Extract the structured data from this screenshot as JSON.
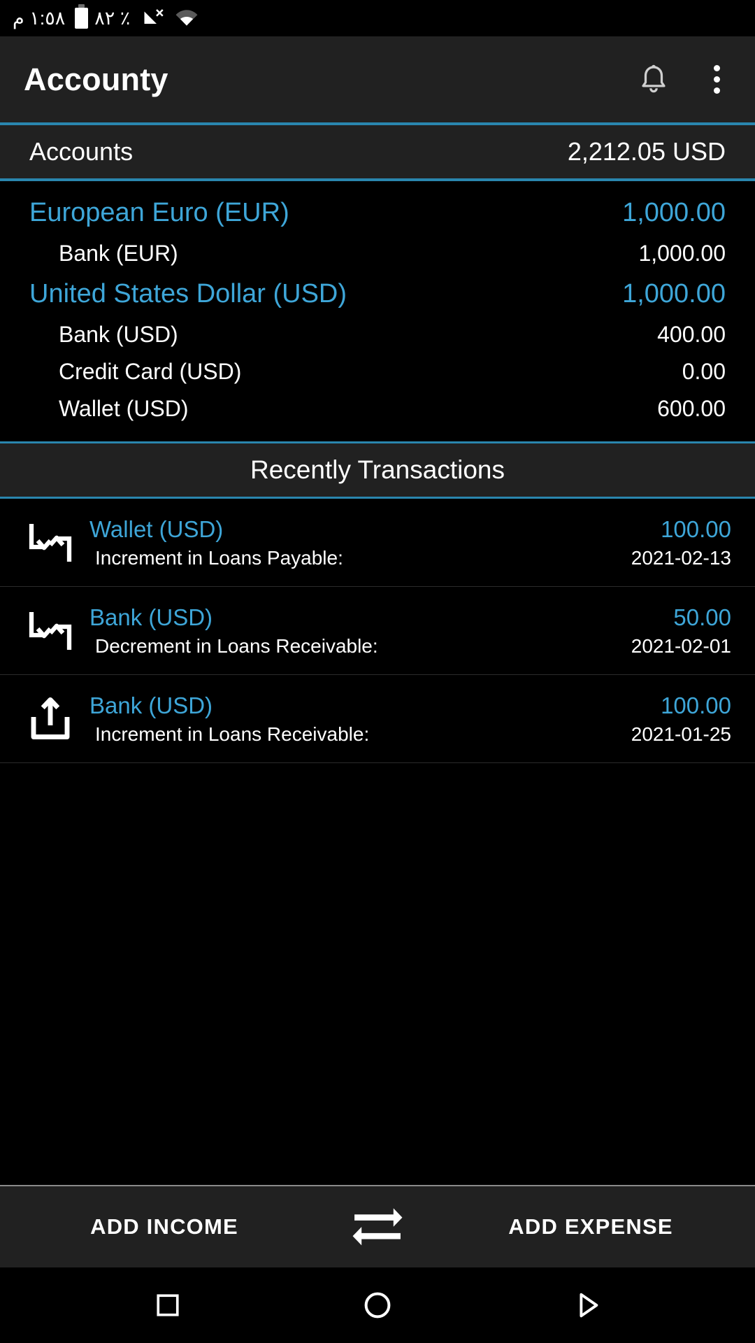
{
  "status_bar": {
    "time": "١:٥٨ م",
    "battery_percent": "٪ ٨٢",
    "battery_icon": "battery-icon",
    "signal_icon": "signal-off-icon",
    "wifi_icon": "wifi-icon"
  },
  "app_bar": {
    "title": "Accounty",
    "notification_icon": "bell-icon",
    "overflow_icon": "more-vertical-icon"
  },
  "accounts_header": {
    "label": "Accounts",
    "total": "2,212.05 USD"
  },
  "accounts": [
    {
      "currency": "European Euro (EUR)",
      "currency_total": "1,000.00",
      "items": [
        {
          "name": "Bank (EUR)",
          "amount": "1,000.00"
        }
      ]
    },
    {
      "currency": "United States Dollar (USD)",
      "currency_total": "1,000.00",
      "items": [
        {
          "name": "Bank (USD)",
          "amount": "400.00"
        },
        {
          "name": "Credit Card (USD)",
          "amount": "0.00"
        },
        {
          "name": "Wallet (USD)",
          "amount": "600.00"
        }
      ]
    }
  ],
  "transactions_section": {
    "title": "Recently Transactions"
  },
  "transactions": [
    {
      "icon": "transfer-icon",
      "account": "Wallet (USD)",
      "amount": "100.00",
      "description": "Increment in Loans Payable:",
      "date": "2021-02-13"
    },
    {
      "icon": "transfer-icon",
      "account": "Bank (USD)",
      "amount": "50.00",
      "description": "Decrement in Loans Receivable:",
      "date": "2021-02-01"
    },
    {
      "icon": "upload-icon",
      "account": "Bank (USD)",
      "amount": "100.00",
      "description": "Increment in Loans Receivable:",
      "date": "2021-01-25"
    }
  ],
  "action_bar": {
    "add_income": "ADD INCOME",
    "transfer_icon": "transfer-arrows-icon",
    "add_expense": "ADD EXPENSE"
  },
  "nav_bar": {
    "back_icon": "square-icon",
    "home_icon": "circle-icon",
    "recents_icon": "triangle-play-icon"
  },
  "colors": {
    "accent": "#2a86ae",
    "link": "#3ea6d8",
    "surface": "#212121",
    "background": "#000000"
  }
}
